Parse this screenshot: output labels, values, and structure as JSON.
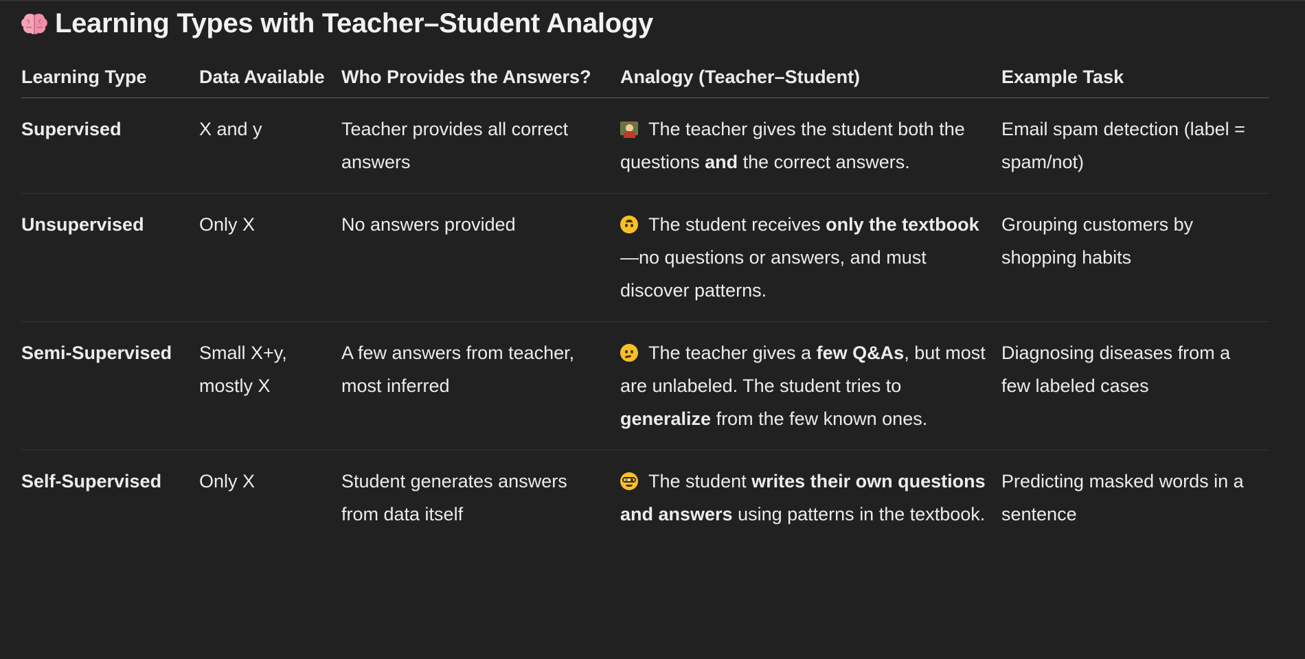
{
  "title": {
    "icon": "brain-icon",
    "text": "Learning Types with Teacher–Student Analogy"
  },
  "table": {
    "headers": [
      "Learning Type",
      "Data Available",
      "Who Provides the Answers?",
      "Analogy (Teacher–Student)",
      "Example Task"
    ],
    "rows": [
      {
        "type": "Supervised",
        "data": "X and y",
        "who": "Teacher provides all correct answers",
        "analogy_icon": "teacher-icon",
        "analogy_segments": [
          {
            "text": " The teacher gives the student both the questions ",
            "bold": false
          },
          {
            "text": "and",
            "bold": true
          },
          {
            "text": " the correct answers.",
            "bold": false
          }
        ],
        "example": "Email spam detection (label = spam/not)"
      },
      {
        "type": "Unsupervised",
        "data": "Only X",
        "who": "No answers provided",
        "analogy_icon": "upside-down-face-icon",
        "analogy_segments": [
          {
            "text": " The student receives ",
            "bold": false
          },
          {
            "text": "only the textbook",
            "bold": true
          },
          {
            "text": "—no questions or answers, and must discover patterns.",
            "bold": false
          }
        ],
        "example": "Grouping customers by shopping habits"
      },
      {
        "type": "Semi-Supervised",
        "data": "Small X+y, mostly X",
        "who": "A few answers from teacher, most inferred",
        "analogy_icon": "thinking-face-icon",
        "analogy_segments": [
          {
            "text": " The teacher gives a ",
            "bold": false
          },
          {
            "text": "few Q&As",
            "bold": true
          },
          {
            "text": ", but most are unlabeled. The student tries to ",
            "bold": false
          },
          {
            "text": "generalize",
            "bold": true
          },
          {
            "text": " from the few known ones.",
            "bold": false
          }
        ],
        "example": "Diagnosing diseases from a few labeled cases"
      },
      {
        "type": "Self-Supervised",
        "data": "Only X",
        "who": "Student generates answers from data itself",
        "analogy_icon": "nerd-face-icon",
        "analogy_segments": [
          {
            "text": " The student ",
            "bold": false
          },
          {
            "text": "writes their own questions and answers",
            "bold": true
          },
          {
            "text": " using patterns in the textbook.",
            "bold": false
          }
        ],
        "example": "Predicting masked words in a sentence"
      }
    ]
  }
}
